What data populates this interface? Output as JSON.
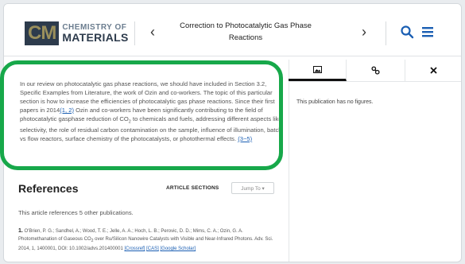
{
  "header": {
    "logo_cm": "CM",
    "logo_line1": "CHEMISTRY OF",
    "logo_line2": "MATERIALS",
    "title": "Correction to Photocatalytic Gas Phase Reactions",
    "prev_label": "‹",
    "next_label": "›"
  },
  "article": {
    "p1": "In our review on photocatalytic gas phase reactions, we should have included in Section 3.2, Specific Examples from Literature, the work of Ozin and co-workers. The topic of this particular section is how to increase the efficiencies of photocatalytic gas phase reactions. Since their first papers in 2014",
    "cite1": "(1, 2)",
    "p2": " Ozin and co-workers have been significantly contributing to the field of photocatalytic gasphase reduction of CO",
    "sub2": "2",
    "p3": " to chemicals and fuels, addressing different aspects like selectivity, the role of residual carbon contamination on the sample, influence of illumination, batch vs flow reactors, surface chemistry of the photocatalysts, or photothermal effects.",
    "cite2": "(3−5)"
  },
  "references": {
    "title": "References",
    "sections_label": "ARTICLE SECTIONS",
    "jump_label": "Jump To ▾",
    "intro": "This article references 5 other publications.",
    "item1_num": "1.",
    "item1_text": " O'Brien, P. G.; Sandhel, A.; Wood, T. E.; Jelle, A. A.; Hoch, L. B.; Perovic, D. D.; Mims, C. A.; Ozin, G. A. Photomethanation of Gaseous CO",
    "item1_sub": "2",
    "item1_text2": " over Ru/Silicon Nanowire Catalysts with Visible and Near-Infrared Photons. Adv. Sci. 2014, 1, 1400001, DOI: 10.1002/advs.201400001",
    "item1_link1": "[Crossref]",
    "item1_link2": "[CAS]",
    "item1_link3": "[Google Scholar]"
  },
  "side_panel": {
    "empty_text": "This publication has no figures."
  }
}
